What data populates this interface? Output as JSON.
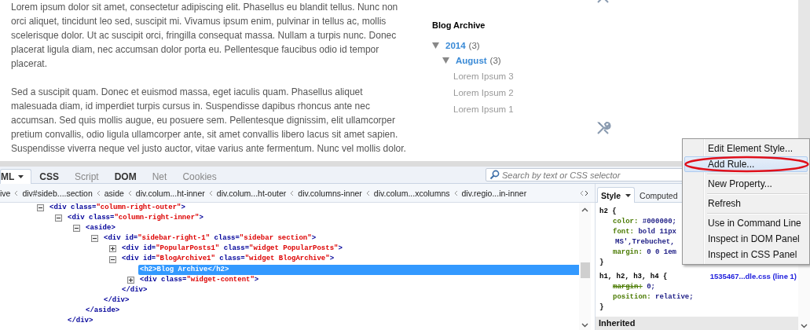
{
  "article": {
    "paragraphs": [
      "Lorem ipsum dolor sit amet, consectetur adipiscing elit. Phasellus eu blandit tellus. Nunc non orci aliquet, tincidunt leo sed, suscipit mi. Vivamus ipsum enim, pulvinar in tellus ac, mollis scelerisque dolor. Ut ac suscipit orci, fringilla consequat massa. Nullam a turpis nunc. Donec placerat ligula diam, nec accumsan dolor porta eu. Pellentesque faucibus odio id tempor placerat.",
      "Sed a suscipit quam. Donec et euismod massa, eget iaculis quam. Phasellus aliquet malesuada diam, id imperdiet turpis cursus in. Suspendisse dapibus rhoncus ante nec accumsan. Sed quis mollis augue, eu posuere sem. Pellentesque dignissim, elit ullamcorper pretium convallis, odio ligula ullamcorper ante, sit amet convallis libero lacus sit amet sapien. Suspendisse viverra neque vel justo auctor, vitae varius ante fermentum. Nunc vel mollis dolor."
    ]
  },
  "sidebar": {
    "title": "Blog Archive",
    "archive": [
      {
        "label": "2014",
        "count": "(3)",
        "expanded": true,
        "children": [
          {
            "label": "August",
            "count": "(3)",
            "expanded": true,
            "children": [
              {
                "label": "Lorem Ipsum 3"
              },
              {
                "label": "Lorem Ipsum 2"
              },
              {
                "label": "Lorem Ipsum 1"
              }
            ]
          }
        ]
      }
    ]
  },
  "devtools": {
    "tabs": [
      {
        "label": "ML",
        "selected": true,
        "disabled": false
      },
      {
        "label": "CSS",
        "selected": false,
        "disabled": false
      },
      {
        "label": "Script",
        "selected": false,
        "disabled": true
      },
      {
        "label": "DOM",
        "selected": false,
        "disabled": false
      },
      {
        "label": "Net",
        "selected": false,
        "disabled": true
      },
      {
        "label": "Cookies",
        "selected": false,
        "disabled": true
      }
    ],
    "search": {
      "placeholder": "Search by text or CSS selector"
    },
    "breadcrumbs": [
      "ive",
      "div#sideb....section",
      "aside",
      "div.colum...ht-inner",
      "div.colum...ht-outer",
      "div.columns-inner",
      "div.colum...xcolumns",
      "div.regio...in-inner"
    ],
    "tree": [
      {
        "expandable": true,
        "expanded": true,
        "selected": false,
        "tokens": [
          {
            "kind": "tag",
            "text": "<div"
          },
          {
            "kind": "attr",
            "text": " class="
          },
          {
            "kind": "value",
            "text": "\"column-right-outer\""
          },
          {
            "kind": "tag",
            "text": ">"
          }
        ],
        "children": [
          {
            "expandable": true,
            "expanded": true,
            "selected": false,
            "tokens": [
              {
                "kind": "tag",
                "text": "<div"
              },
              {
                "kind": "attr",
                "text": " class="
              },
              {
                "kind": "value",
                "text": "\"column-right-inner\""
              },
              {
                "kind": "tag",
                "text": ">"
              }
            ],
            "close": "</div>",
            "children": [
              {
                "expandable": true,
                "expanded": true,
                "selected": false,
                "tokens": [
                  {
                    "kind": "tag",
                    "text": "<aside>"
                  }
                ],
                "close": "</aside>",
                "children": [
                  {
                    "expandable": true,
                    "expanded": true,
                    "selected": false,
                    "tokens": [
                      {
                        "kind": "tag",
                        "text": "<div"
                      },
                      {
                        "kind": "attr",
                        "text": " id="
                      },
                      {
                        "kind": "value",
                        "text": "\"sidebar-right-1\""
                      },
                      {
                        "kind": "attr",
                        "text": " class="
                      },
                      {
                        "kind": "value",
                        "text": "\"sidebar section\""
                      },
                      {
                        "kind": "tag",
                        "text": ">"
                      }
                    ],
                    "close": "</div>",
                    "children": [
                      {
                        "expandable": true,
                        "expanded": false,
                        "selected": false,
                        "tokens": [
                          {
                            "kind": "tag",
                            "text": "<div"
                          },
                          {
                            "kind": "attr",
                            "text": " id="
                          },
                          {
                            "kind": "value",
                            "text": "\"PopularPosts1\""
                          },
                          {
                            "kind": "attr",
                            "text": " class="
                          },
                          {
                            "kind": "value",
                            "text": "\"widget PopularPosts\""
                          },
                          {
                            "kind": "tag",
                            "text": ">"
                          }
                        ]
                      },
                      {
                        "expandable": true,
                        "expanded": true,
                        "selected": false,
                        "tokens": [
                          {
                            "kind": "tag",
                            "text": "<div"
                          },
                          {
                            "kind": "attr",
                            "text": " id="
                          },
                          {
                            "kind": "value",
                            "text": "\"BlogArchive1\""
                          },
                          {
                            "kind": "attr",
                            "text": " class="
                          },
                          {
                            "kind": "value",
                            "text": "\"widget BlogArchive\""
                          },
                          {
                            "kind": "tag",
                            "text": ">"
                          }
                        ],
                        "close": "</div>",
                        "children": [
                          {
                            "expandable": false,
                            "selected": true,
                            "tokens": [
                              {
                                "kind": "tag",
                                "text": "<h2>"
                              },
                              {
                                "kind": "text",
                                "text": "Blog Archive"
                              },
                              {
                                "kind": "tag",
                                "text": "</h2>"
                              }
                            ]
                          },
                          {
                            "expandable": true,
                            "expanded": false,
                            "selected": false,
                            "tokens": [
                              {
                                "kind": "tag",
                                "text": "<div"
                              },
                              {
                                "kind": "attr",
                                "text": " class="
                              },
                              {
                                "kind": "value",
                                "text": "\"widget-content\""
                              },
                              {
                                "kind": "tag",
                                "text": ">"
                              }
                            ]
                          }
                        ]
                      }
                    ]
                  }
                ]
              }
            ]
          }
        ]
      }
    ],
    "side_tabs": [
      {
        "label": "Style",
        "selected": true
      },
      {
        "label": "Computed",
        "selected": false
      }
    ],
    "rules": [
      {
        "selector": "h2 {",
        "props": [
          {
            "kind": "property",
            "name": "color:",
            "value": "#000000;",
            "overridden": false
          },
          {
            "kind": "property",
            "name": "font:",
            "value": "bold 11px",
            "overridden": false
          },
          {
            "kind": "continuation",
            "value": "MS',Trebuchet,"
          },
          {
            "kind": "property",
            "name": "margin:",
            "value": "0 0 1em",
            "overridden": false
          }
        ],
        "end": "}"
      },
      {
        "selector": "h1, h2, h3, h4 {",
        "source": "1535467...dle.css (line 1)",
        "props": [
          {
            "kind": "property",
            "name": "margin:",
            "value": "0;",
            "overridden": true
          },
          {
            "kind": "property",
            "name": "position:",
            "value": "relative;",
            "overridden": false
          }
        ],
        "end": "}"
      }
    ],
    "inherited": "Inherited"
  },
  "context_menu": {
    "items": [
      {
        "kind": "item",
        "label": "Edit Element Style...",
        "selected": false,
        "circled": false
      },
      {
        "kind": "item",
        "label": "Add Rule...",
        "selected": true,
        "circled": true
      },
      {
        "kind": "separator"
      },
      {
        "kind": "item",
        "label": "New Property...",
        "selected": false,
        "circled": false
      },
      {
        "kind": "separator"
      },
      {
        "kind": "item",
        "label": "Refresh",
        "selected": false,
        "circled": false
      },
      {
        "kind": "separator"
      },
      {
        "kind": "item",
        "label": "Use in Command Line",
        "selected": false,
        "circled": false
      },
      {
        "kind": "item",
        "label": "Inspect in DOM Panel",
        "selected": false,
        "circled": false
      },
      {
        "kind": "item",
        "label": "Inspect in CSS Panel",
        "selected": false,
        "circled": false
      }
    ]
  }
}
